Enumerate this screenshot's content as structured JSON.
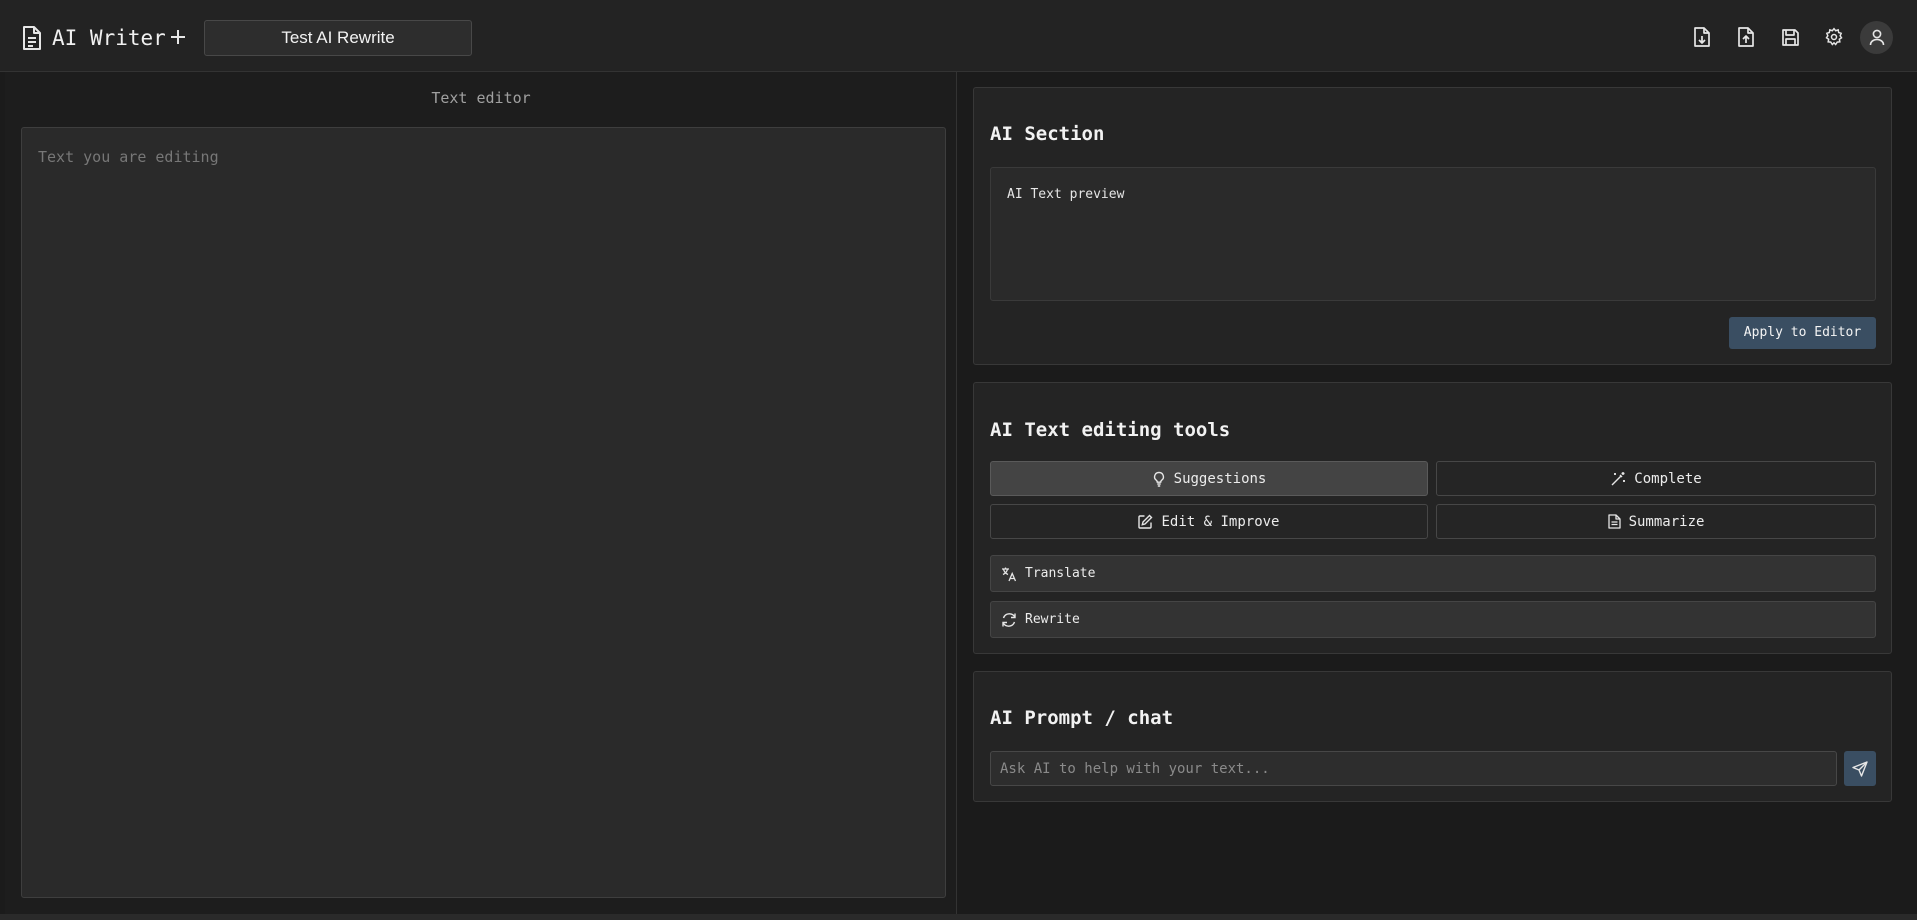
{
  "app": {
    "title": "AI Writer",
    "document_title": "Test AI Rewrite"
  },
  "toolbar": {
    "icons": [
      "file-download-icon",
      "file-upload-icon",
      "save-icon",
      "gear-icon",
      "user-icon"
    ]
  },
  "editor": {
    "label": "Text editor",
    "placeholder": "Text you are editing",
    "value": ""
  },
  "ai_section": {
    "title": "AI Section",
    "preview_text": "AI Text preview",
    "apply_label": "Apply to Editor"
  },
  "tools": {
    "title": "AI Text editing tools",
    "suggestions": "Suggestions",
    "complete": "Complete",
    "edit_improve": "Edit & Improve",
    "summarize": "Summarize",
    "translate": "Translate",
    "rewrite": "Rewrite"
  },
  "chat": {
    "title": "AI Prompt / chat",
    "placeholder": "Ask AI to help with your text..."
  },
  "colors": {
    "background": "#1b1b1b",
    "panel": "#242424",
    "accent": "#3a4e62"
  }
}
